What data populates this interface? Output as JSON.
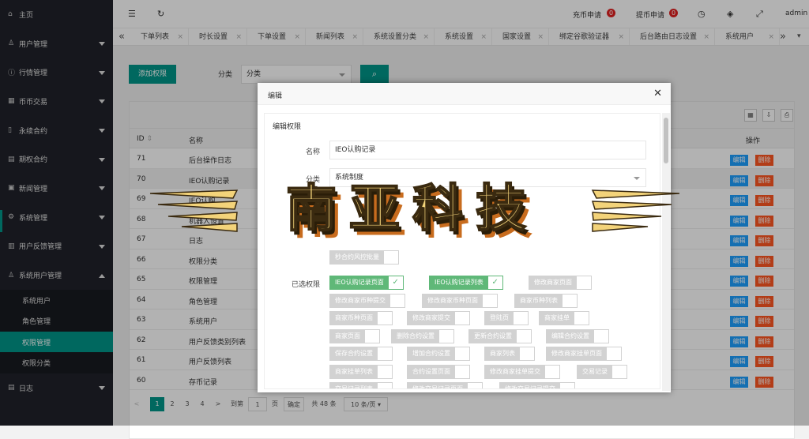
{
  "sidebar": {
    "items": [
      {
        "label": "主页",
        "icon": "home-icon",
        "glyph": "⌂",
        "arrow": false
      },
      {
        "label": "用户管理",
        "icon": "user-icon",
        "glyph": "♙",
        "arrow": true
      },
      {
        "label": "行情管理",
        "icon": "info-icon",
        "glyph": "ⓘ",
        "arrow": true
      },
      {
        "label": "币币交易",
        "icon": "grid-icon",
        "glyph": "▦",
        "arrow": true
      },
      {
        "label": "永续合约",
        "icon": "file-icon",
        "glyph": "▯",
        "arrow": true
      },
      {
        "label": "期权合约",
        "icon": "doc-icon",
        "glyph": "▤",
        "arrow": true
      },
      {
        "label": "新闻管理",
        "icon": "news-icon",
        "glyph": "▣",
        "arrow": true
      },
      {
        "label": "系统管理",
        "icon": "gear-icon",
        "glyph": "⚙",
        "arrow": true
      },
      {
        "label": "用户反馈管理",
        "icon": "feedback-icon",
        "glyph": "▥",
        "arrow": true
      },
      {
        "label": "系统用户管理",
        "icon": "users-icon",
        "glyph": "♙",
        "arrow": true
      }
    ],
    "sub_items": [
      "系统用户",
      "角色管理",
      "权限管理",
      "权限分类"
    ],
    "last_item": {
      "label": "日志",
      "glyph": "▤"
    }
  },
  "header": {
    "recharge_label": "充币申请",
    "recharge_count": "0",
    "withdraw_label": "提币申请",
    "withdraw_count": "0",
    "user": "admin"
  },
  "tabs": [
    "下单列表",
    "时长设置",
    "下单设置",
    "新闻列表",
    "系统设置分类",
    "系统设置",
    "国家设置",
    "绑定谷歌验证器",
    "后台路由日志设置",
    "系统用户"
  ],
  "toolbar": {
    "add_label": "添加权限",
    "category_label": "分类",
    "category_value": "分类"
  },
  "table": {
    "headers": {
      "id": "ID",
      "name": "名称",
      "action": "操作"
    },
    "edit_label": "编辑",
    "delete_label": "删除",
    "rows": [
      {
        "id": "71",
        "name": "后台操作日志"
      },
      {
        "id": "70",
        "name": "IEO认购记录"
      },
      {
        "id": "69",
        "name": "IEO认购"
      },
      {
        "id": "68",
        "name": "机器人设置"
      },
      {
        "id": "67",
        "name": "日志"
      },
      {
        "id": "66",
        "name": "权限分类"
      },
      {
        "id": "65",
        "name": "权限管理"
      },
      {
        "id": "64",
        "name": "角色管理"
      },
      {
        "id": "63",
        "name": "系统用户"
      },
      {
        "id": "62",
        "name": "用户反馈类别列表"
      },
      {
        "id": "61",
        "name": "用户反馈列表"
      },
      {
        "id": "60",
        "name": "存币记录"
      }
    ]
  },
  "pager": {
    "prev": "<",
    "pages": [
      "1",
      "2",
      "3",
      "4"
    ],
    "next": ">",
    "goto_label": "到第",
    "goto_value": "1",
    "page_unit": "页",
    "confirm": "确定",
    "total": "共 48 条",
    "per_page": "10 条/页"
  },
  "modal": {
    "title": "编辑",
    "section": "编辑权限",
    "name_label": "名称",
    "name_value": "IEO认购记录",
    "category_label": "分类",
    "category_value": "系统制度",
    "perm_label": "权限",
    "selected_label": "已选权限",
    "perm_options": [
      "秒合约风控批量"
    ],
    "selected": [
      {
        "label": "IEO认购记录页面",
        "on": true
      },
      {
        "label": "IEO认购记录列表",
        "on": true
      },
      {
        "label": "修改商家页面",
        "on": false
      },
      {
        "label": "修改商家币种提交",
        "on": false
      },
      {
        "label": "修改商家币种页面",
        "on": false
      },
      {
        "label": "商家币种列表",
        "on": false
      },
      {
        "label": "商家币种页面",
        "on": false
      },
      {
        "label": "修改商家提交",
        "on": false
      },
      {
        "label": "登陆页",
        "on": false
      },
      {
        "label": "商家挂单",
        "on": false
      },
      {
        "label": "商家页面",
        "on": false
      },
      {
        "label": "删除合约设置",
        "on": false
      },
      {
        "label": "更新合约设置",
        "on": false
      },
      {
        "label": "编辑合约设置",
        "on": false
      },
      {
        "label": "保存合约设置",
        "on": false
      },
      {
        "label": "增加合约设置",
        "on": false
      },
      {
        "label": "商家列表",
        "on": false
      },
      {
        "label": "修改商家挂单页面",
        "on": false
      },
      {
        "label": "商家挂单列表",
        "on": false
      },
      {
        "label": "合约设置页面",
        "on": false
      },
      {
        "label": "修改商家挂单提交",
        "on": false
      },
      {
        "label": "交易记录",
        "on": false
      },
      {
        "label": "交易记录列表",
        "on": false
      },
      {
        "label": "修改交易记录页面",
        "on": false
      },
      {
        "label": "修改交易记录提交",
        "on": false
      }
    ]
  },
  "watermark": {
    "text": "南亚科技"
  }
}
